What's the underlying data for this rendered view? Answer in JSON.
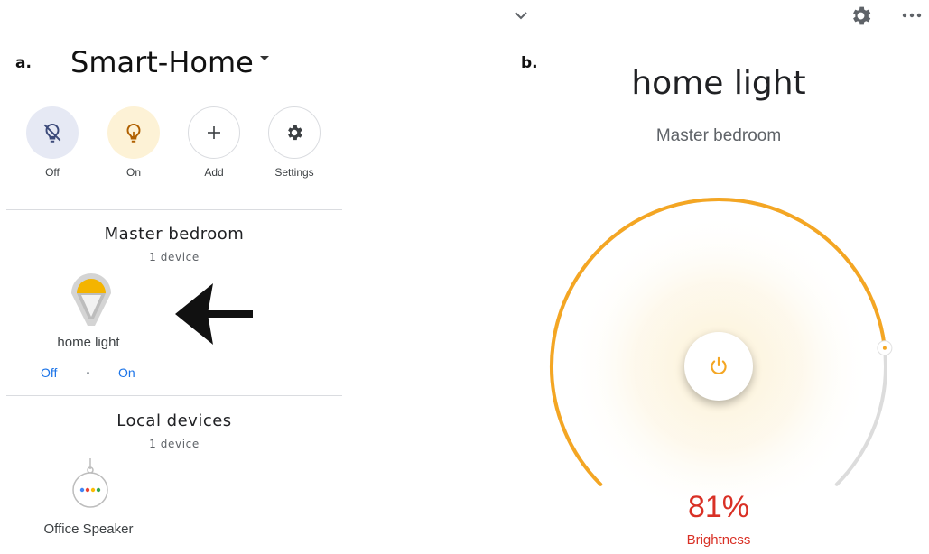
{
  "panel_a": {
    "label": "a.",
    "home_name": "Smart-Home",
    "quick_actions": [
      {
        "label": "Off",
        "icon": "light-off-icon"
      },
      {
        "label": "On",
        "icon": "lightbulb-icon"
      },
      {
        "label": "Add",
        "icon": "plus-icon"
      },
      {
        "label": "Settings",
        "icon": "gear-icon"
      }
    ],
    "rooms": [
      {
        "title": "Master bedroom",
        "count": "1 device",
        "device": {
          "name": "home light",
          "off_label": "Off",
          "on_label": "On"
        }
      },
      {
        "title": "Local devices",
        "count": "1 device",
        "device": {
          "name": "Office Speaker"
        }
      }
    ]
  },
  "panel_b": {
    "label": "b.",
    "device_name": "home light",
    "room": "Master bedroom",
    "brightness_text": "81%",
    "brightness_fraction": 0.81,
    "brightness_label": "Brightness"
  },
  "colors": {
    "accent_orange": "#f4a623",
    "brightness_red": "#d93025",
    "link_blue": "#1a73e8",
    "off_bg": "#e6e9f4",
    "on_bg": "#fdf2d6"
  }
}
